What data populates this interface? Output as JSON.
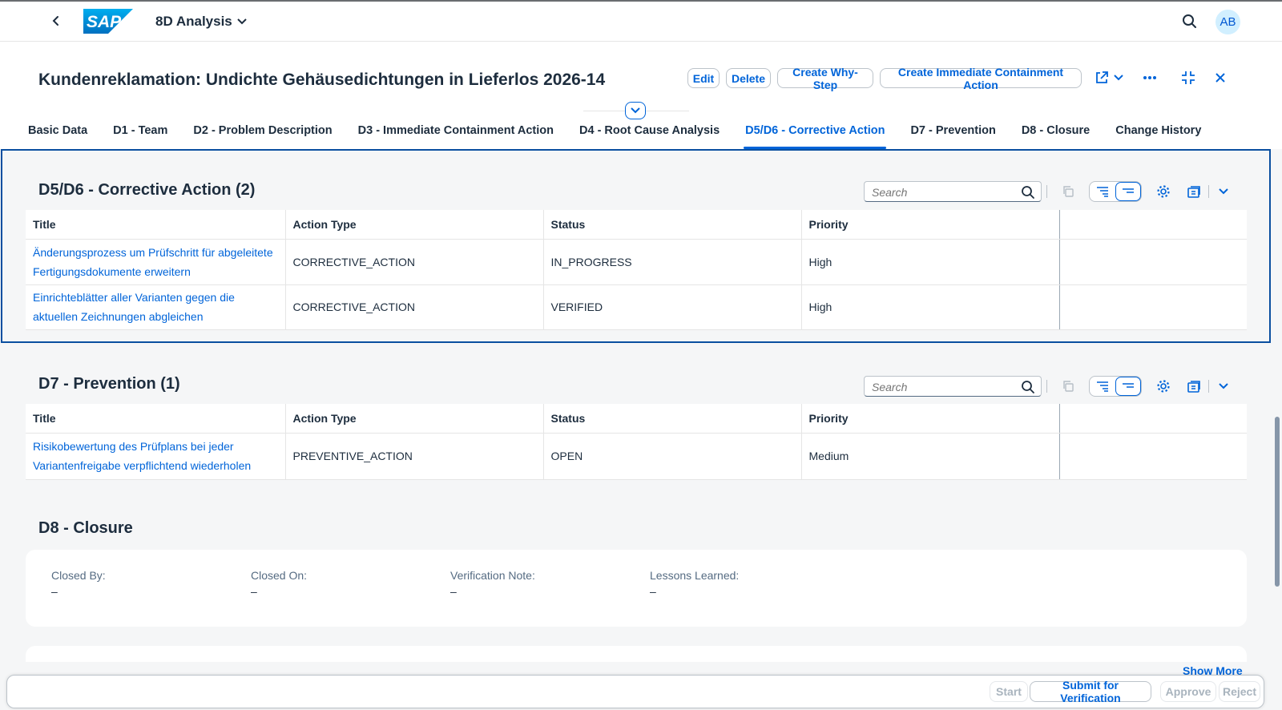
{
  "shell": {
    "app_title": "8D Analysis",
    "logo_text": "SAP",
    "avatar_initials": "AB",
    "icons": [
      "chevron-left-icon",
      "chevron-down-icon",
      "search-icon"
    ]
  },
  "header": {
    "title": "Kundenreklamation: Undichte Gehäusedichtungen in Lieferlos 2026-14",
    "actions": {
      "edit": "Edit",
      "delete": "Delete",
      "create_why_step": "Create Why-Step",
      "create_ica": "Create Immediate Containment Action"
    },
    "icons": [
      "share-icon",
      "chevron-down-icon",
      "overflow-icon",
      "exit-fullscreen-icon",
      "close-icon",
      "collapse-header-icon"
    ]
  },
  "tabs": [
    {
      "label": "Basic Data",
      "active": false
    },
    {
      "label": "D1 - Team",
      "active": false
    },
    {
      "label": "D2 - Problem Description",
      "active": false
    },
    {
      "label": "D3 - Immediate Containment Action",
      "active": false
    },
    {
      "label": "D4 - Root Cause Analysis",
      "active": false
    },
    {
      "label": "D5/D6 - Corrective Action",
      "active": true
    },
    {
      "label": "D7 - Prevention",
      "active": false
    },
    {
      "label": "D8 - Closure",
      "active": false
    },
    {
      "label": "Change History",
      "active": false
    }
  ],
  "corrective": {
    "title": "D5/D6 - Corrective Action (2)",
    "search_placeholder": "Search",
    "columns": [
      "Title",
      "Action Type",
      "Status",
      "Priority"
    ],
    "rows": [
      {
        "title_line1": "Änderungsprozess um Prüfschritt für abgeleitete",
        "title_line2": "Fertigungsdokumente erweitern",
        "action_type": "CORRECTIVE_ACTION",
        "status": "IN_PROGRESS",
        "priority": "High"
      },
      {
        "title_line1": "Einrichteblätter aller Varianten gegen die",
        "title_line2": "aktuellen Zeichnungen abgleichen",
        "action_type": "CORRECTIVE_ACTION",
        "status": "VERIFIED",
        "priority": "High"
      }
    ]
  },
  "prevention": {
    "title": "D7 - Prevention (1)",
    "search_placeholder": "Search",
    "columns": [
      "Title",
      "Action Type",
      "Status",
      "Priority"
    ],
    "rows": [
      {
        "title_line1": "Risikobewertung des Prüfplans bei jeder",
        "title_line2": "Variantenfreigabe verpflichtend wiederholen",
        "action_type": "PREVENTIVE_ACTION",
        "status": "OPEN",
        "priority": "Medium"
      }
    ]
  },
  "closure": {
    "title": "D8 - Closure",
    "fields": [
      {
        "label": "Closed By:",
        "value": "–"
      },
      {
        "label": "Closed On:",
        "value": "–"
      },
      {
        "label": "Verification Note:",
        "value": "–"
      },
      {
        "label": "Lessons Learned:",
        "value": "–"
      }
    ],
    "show_more": "Show More"
  },
  "footer": {
    "start": "Start",
    "submit": "Submit for Verification",
    "approve": "Approve",
    "reject": "Reject"
  },
  "colors": {
    "brand_blue": "#0064d9",
    "focus_frame": "#0a4fa0",
    "background": "#f5f6f7"
  }
}
